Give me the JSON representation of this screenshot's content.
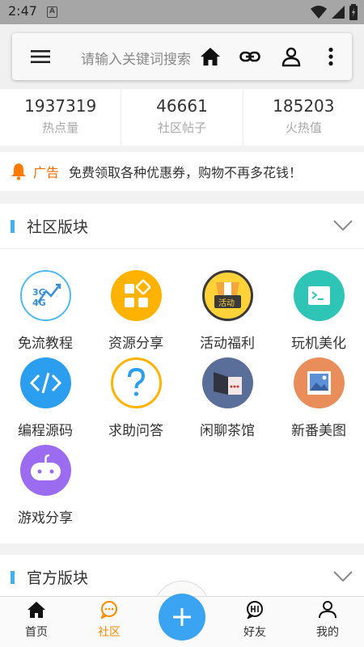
{
  "status_bar": {
    "time": "2:47",
    "notification_badge": "A"
  },
  "search": {
    "placeholder": "请输入关键词搜索"
  },
  "stats": [
    {
      "value": "1937319",
      "label": "热点量"
    },
    {
      "value": "46661",
      "label": "社区帖子"
    },
    {
      "value": "185203",
      "label": "火热值"
    }
  ],
  "ad": {
    "tag": "广告",
    "message": "免费领取各种优惠券，购物不再多花钱！"
  },
  "community_section": {
    "title": "社区版块",
    "items": [
      {
        "label": "免流教程",
        "icon": "3g-4g-icon",
        "color": "#ffffff",
        "icon_text_top": "3G",
        "icon_text_bottom": "4G"
      },
      {
        "label": "资源分享",
        "icon": "resource-grid-icon",
        "color": "#ffb300"
      },
      {
        "label": "活动福利",
        "icon": "gift-box-icon",
        "color": "#ffd23a",
        "icon_text": "活动"
      },
      {
        "label": "玩机美化",
        "icon": "terminal-icon",
        "color": "#2ec4b6"
      },
      {
        "label": "编程源码",
        "icon": "code-icon",
        "color": "#2b9ef0"
      },
      {
        "label": "求助问答",
        "icon": "question-icon",
        "color": "#ffffff"
      },
      {
        "label": "闲聊茶馆",
        "icon": "tea-house-icon",
        "color": "#5a6e9a"
      },
      {
        "label": "新番美图",
        "icon": "picture-icon",
        "color": "#e98d5a"
      },
      {
        "label": "游戏分享",
        "icon": "gamepad-icon",
        "color": "#9b6cf0"
      }
    ]
  },
  "official_section": {
    "title": "官方版块"
  },
  "bottom_nav": [
    {
      "label": "首页",
      "icon": "home-icon",
      "active": false
    },
    {
      "label": "社区",
      "icon": "chat-icon",
      "active": true
    },
    {
      "label": "好友",
      "icon": "hi-bubble-icon",
      "active": false
    },
    {
      "label": "我的",
      "icon": "person-icon",
      "active": false
    }
  ],
  "colors": {
    "accent": "#3fb0f0",
    "active": "#ff8a00",
    "ad_tag": "#ff6a00",
    "fab": "#3aa4f2"
  }
}
